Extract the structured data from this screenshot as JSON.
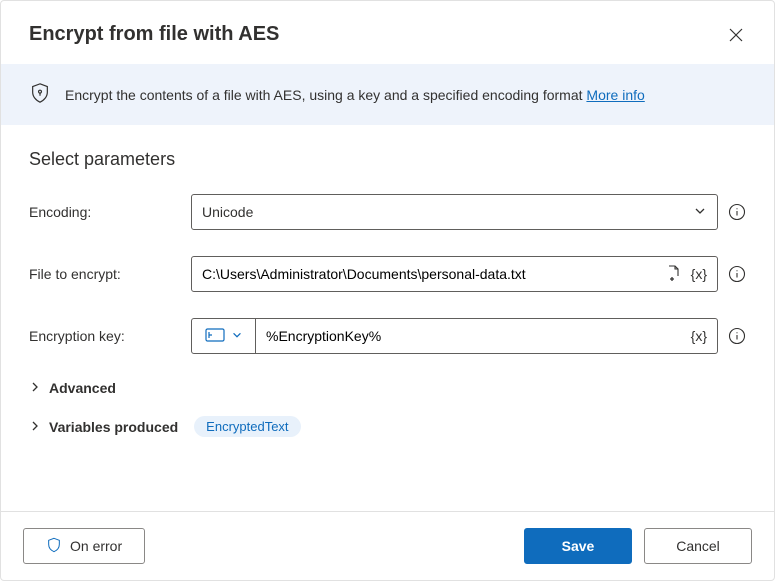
{
  "dialog": {
    "title": "Encrypt from file with AES",
    "banner_text": "Encrypt the contents of a file with AES, using a key and a specified encoding format ",
    "banner_link": "More info"
  },
  "section": {
    "title": "Select parameters"
  },
  "fields": {
    "encoding_label": "Encoding:",
    "encoding_value": "Unicode",
    "file_label": "File to encrypt:",
    "file_value": "C:\\Users\\Administrator\\Documents\\personal-data.txt",
    "key_label": "Encryption key:",
    "key_value": "%EncryptionKey%"
  },
  "expanders": {
    "advanced": "Advanced",
    "variables_produced": "Variables produced",
    "variable_chip": "EncryptedText"
  },
  "footer": {
    "on_error": "On error",
    "save": "Save",
    "cancel": "Cancel"
  }
}
